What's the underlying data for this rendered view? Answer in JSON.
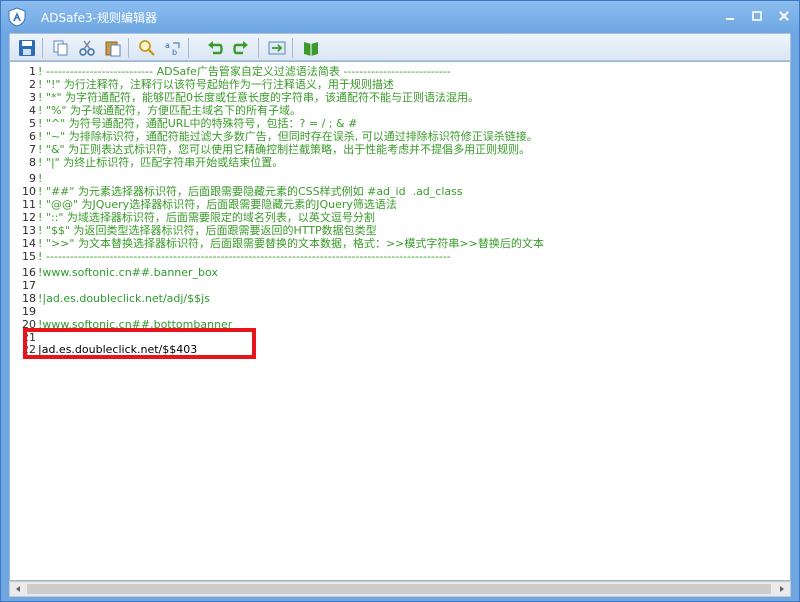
{
  "window": {
    "title": "ADSafe3-规则编辑器",
    "accent": "#6ea7e2"
  },
  "toolbar": {
    "buttons": [
      {
        "name": "save-icon"
      },
      {
        "name": "copy-icon"
      },
      {
        "name": "cut-icon"
      },
      {
        "name": "paste-icon"
      },
      {
        "name": "find-icon"
      },
      {
        "name": "replace-icon"
      },
      {
        "name": "undo-icon"
      },
      {
        "name": "redo-icon"
      },
      {
        "name": "goto-icon"
      },
      {
        "name": "book-icon"
      }
    ]
  },
  "editor": {
    "lines": [
      {
        "n": "1",
        "text": "! --------------------------- ADSafe广告管家自定义过滤语法简表 ---------------------------",
        "kind": "comment"
      },
      {
        "n": "2",
        "text": "! \"!\" 为行注释符，注释行以该符号起始作为一行注释语义，用于规则描述",
        "kind": "comment"
      },
      {
        "n": "3",
        "text": "! \"*\" 为字符通配符，能够匹配0长度或任意长度的字符串，该通配符不能与正则语法混用。",
        "kind": "comment"
      },
      {
        "n": "4",
        "text": "! \"%\" 为子域通配符，方便匹配主域名下的所有子域。",
        "kind": "comment"
      },
      {
        "n": "5",
        "text": "! \"^\" 为符号通配符，通配URL中的特殊符号，包括：? = / ; & #",
        "kind": "comment"
      },
      {
        "n": "6",
        "text": "! \"~\" 为排除标识符，通配符能过滤大多数广告，但同时存在误杀, 可以通过排除标识符修正误杀链接。",
        "kind": "comment"
      },
      {
        "n": "7",
        "text": "! \"&\" 为正则表达式标识符，您可以使用它精确控制拦截策略，出于性能考虑并不提倡多用正则规则。",
        "kind": "comment"
      },
      {
        "n": "8",
        "text": "! \"|\" 为终止标识符，匹配字符串开始或结束位置。",
        "kind": "comment"
      },
      {
        "n": "9",
        "text": "!",
        "kind": "comment"
      },
      {
        "n": "10",
        "text": "! \"##\" 为元素选择器标识符，后面跟需要隐藏元素的CSS样式例如 #ad_id  .ad_class",
        "kind": "comment"
      },
      {
        "n": "11",
        "text": "! \"@@\" 为JQuery选择器标识符，后面跟需要隐藏元素的JQuery筛选语法",
        "kind": "comment"
      },
      {
        "n": "12",
        "text": "! \"::\" 为域选择器标识符，后面需要限定的域名列表，以英文逗号分割",
        "kind": "comment"
      },
      {
        "n": "13",
        "text": "! \"$$\" 为返回类型选择器标识符，后面跟需要返回的HTTP数据包类型",
        "kind": "comment"
      },
      {
        "n": "14",
        "text": "! \">>\" 为文本替换选择器标识符，后面跟需要替换的文本数据，格式：>>模式字符串>>替换后的文本",
        "kind": "comment"
      },
      {
        "n": "15",
        "text": "! ------------------------------------------------------------------------------------------------------",
        "kind": "comment"
      },
      {
        "n": "16",
        "text": "!www.softonic.cn##.banner_box",
        "kind": "rule"
      },
      {
        "n": "17",
        "text": "",
        "kind": "plain"
      },
      {
        "n": "18",
        "text": "!|ad.es.doubleclick.net/adj/$$js",
        "kind": "rule"
      },
      {
        "n": "19",
        "text": "",
        "kind": "plain"
      },
      {
        "n": "20",
        "text": "!www.softonic.cn##.bottombanner",
        "kind": "rule"
      },
      {
        "n": "21",
        "text": "",
        "kind": "plain"
      },
      {
        "n": "22",
        "text": "|ad.es.doubleclick.net/$$403",
        "kind": "plain"
      }
    ]
  },
  "annotation": {
    "box_color": "#e8141c"
  }
}
